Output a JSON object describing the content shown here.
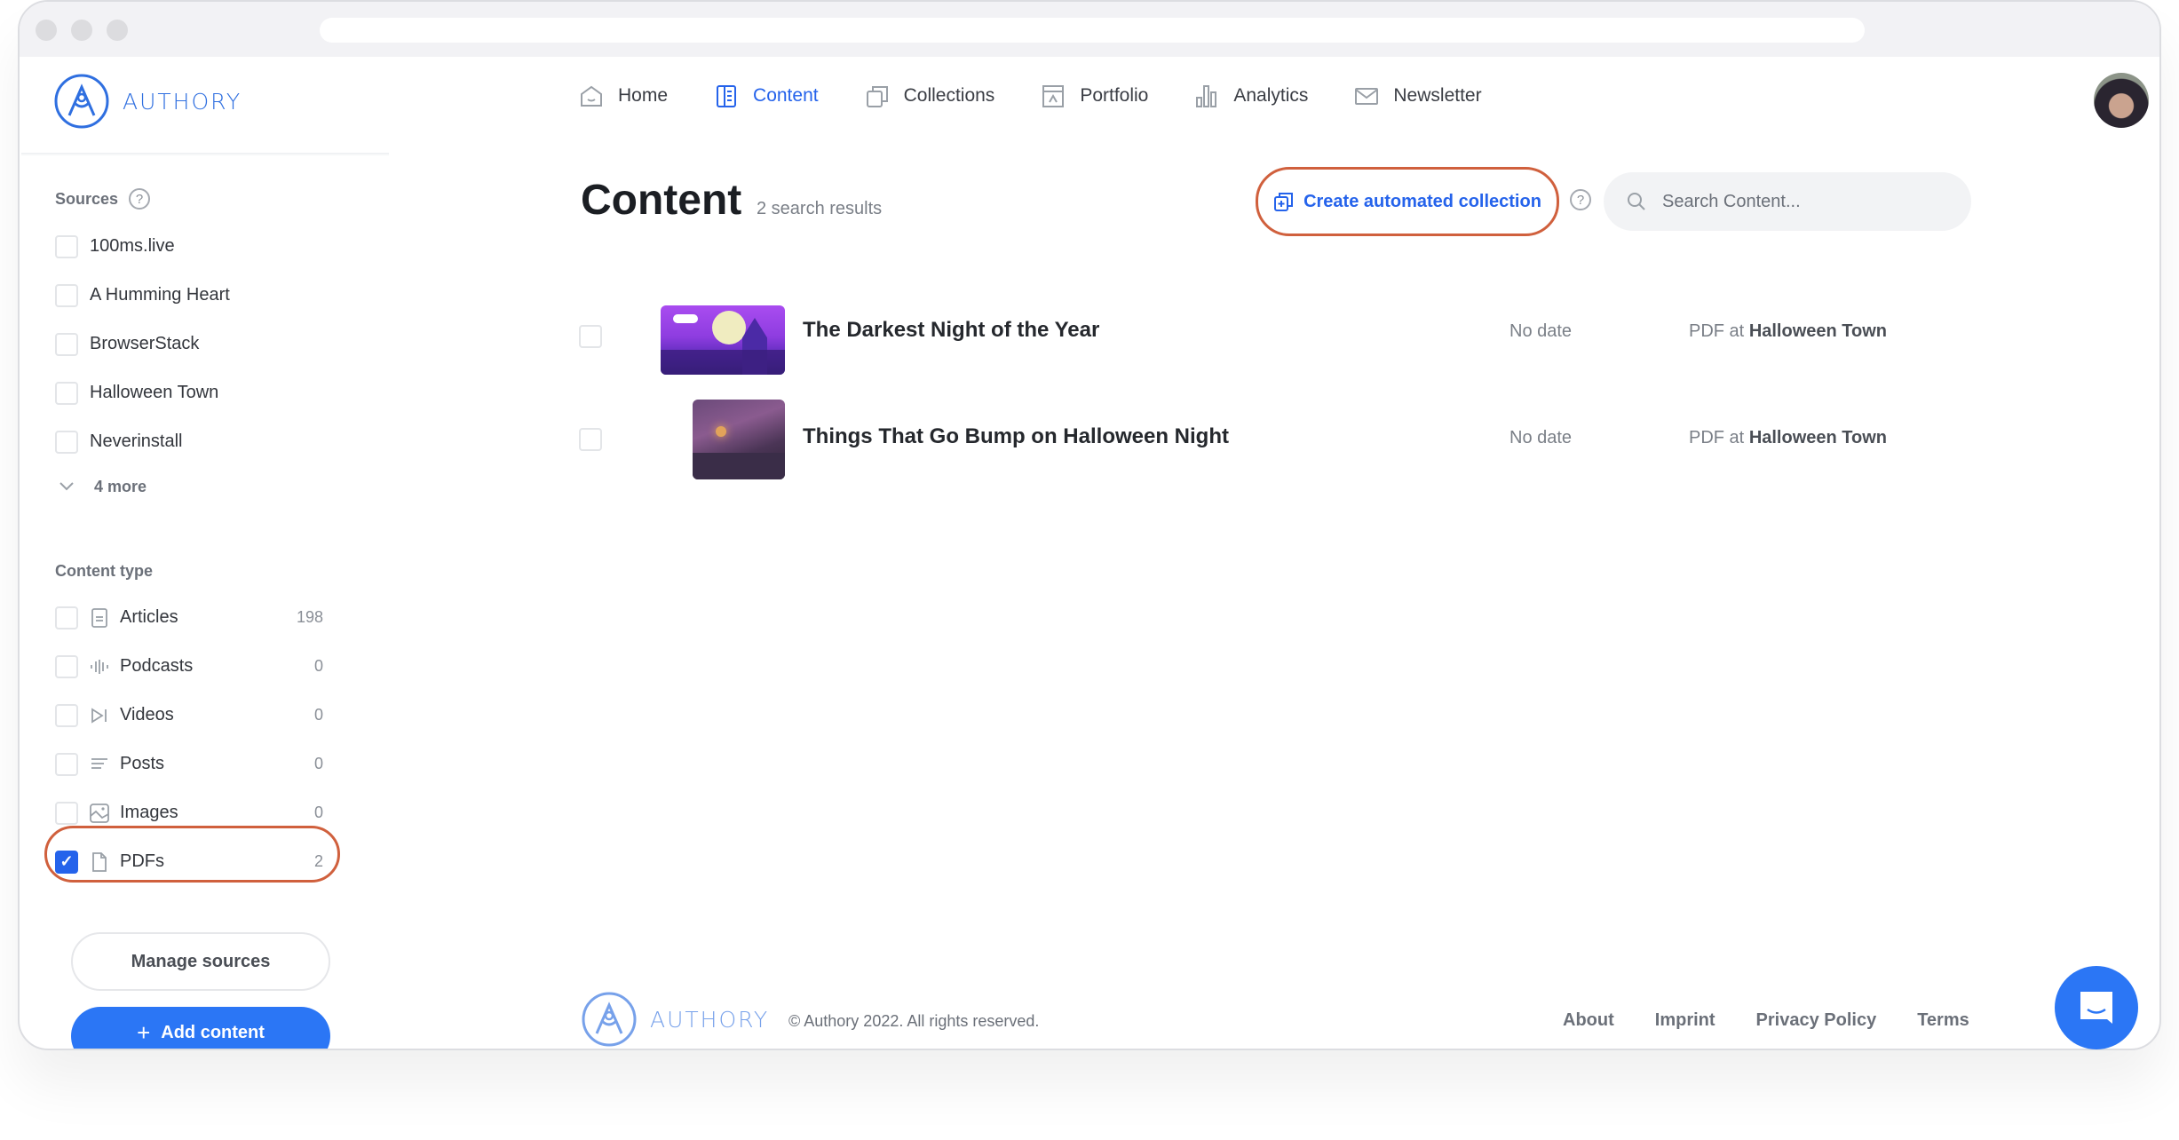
{
  "app": {
    "brand": "AUTHORY",
    "brand_color": "#2f6fe0",
    "accent": "#2563eb",
    "highlight_ring": "#d0603d"
  },
  "nav": [
    {
      "label": "Home",
      "icon": "home-icon",
      "active": false
    },
    {
      "label": "Content",
      "icon": "content-icon",
      "active": true
    },
    {
      "label": "Collections",
      "icon": "collections-icon",
      "active": false
    },
    {
      "label": "Portfolio",
      "icon": "portfolio-icon",
      "active": false
    },
    {
      "label": "Analytics",
      "icon": "analytics-icon",
      "active": false
    },
    {
      "label": "Newsletter",
      "icon": "newsletter-icon",
      "active": false
    }
  ],
  "sidebar": {
    "sources_title": "Sources",
    "sources": [
      {
        "label": "100ms.live",
        "checked": false
      },
      {
        "label": "A Humming Heart",
        "checked": false
      },
      {
        "label": "BrowserStack",
        "checked": false
      },
      {
        "label": "Halloween Town",
        "checked": false
      },
      {
        "label": "Neverinstall",
        "checked": false
      }
    ],
    "more_label": "4 more",
    "content_type_title": "Content type",
    "content_types": [
      {
        "label": "Articles",
        "count": "198",
        "icon": "article-icon",
        "checked": false
      },
      {
        "label": "Podcasts",
        "count": "0",
        "icon": "podcast-icon",
        "checked": false
      },
      {
        "label": "Videos",
        "count": "0",
        "icon": "video-icon",
        "checked": false
      },
      {
        "label": "Posts",
        "count": "0",
        "icon": "post-icon",
        "checked": false
      },
      {
        "label": "Images",
        "count": "0",
        "icon": "image-icon",
        "checked": false
      },
      {
        "label": "PDFs",
        "count": "2",
        "icon": "pdf-icon",
        "checked": true
      }
    ],
    "manage_sources": "Manage sources",
    "add_content": "Add content"
  },
  "main": {
    "title": "Content",
    "results": "2 search results",
    "create_collection": "Create automated collection",
    "search_placeholder": "Search Content...",
    "items": [
      {
        "title": "The Darkest Night of the Year",
        "date": "No date",
        "type": "PDF at",
        "source": "Halloween Town"
      },
      {
        "title": "Things That Go Bump on Halloween Night",
        "date": "No date",
        "type": "PDF at",
        "source": "Halloween Town"
      }
    ]
  },
  "footer": {
    "brand": "AUTHORY",
    "copyright": "© Authory 2022. All rights reserved.",
    "links": [
      "About",
      "Imprint",
      "Privacy Policy",
      "Terms"
    ]
  }
}
